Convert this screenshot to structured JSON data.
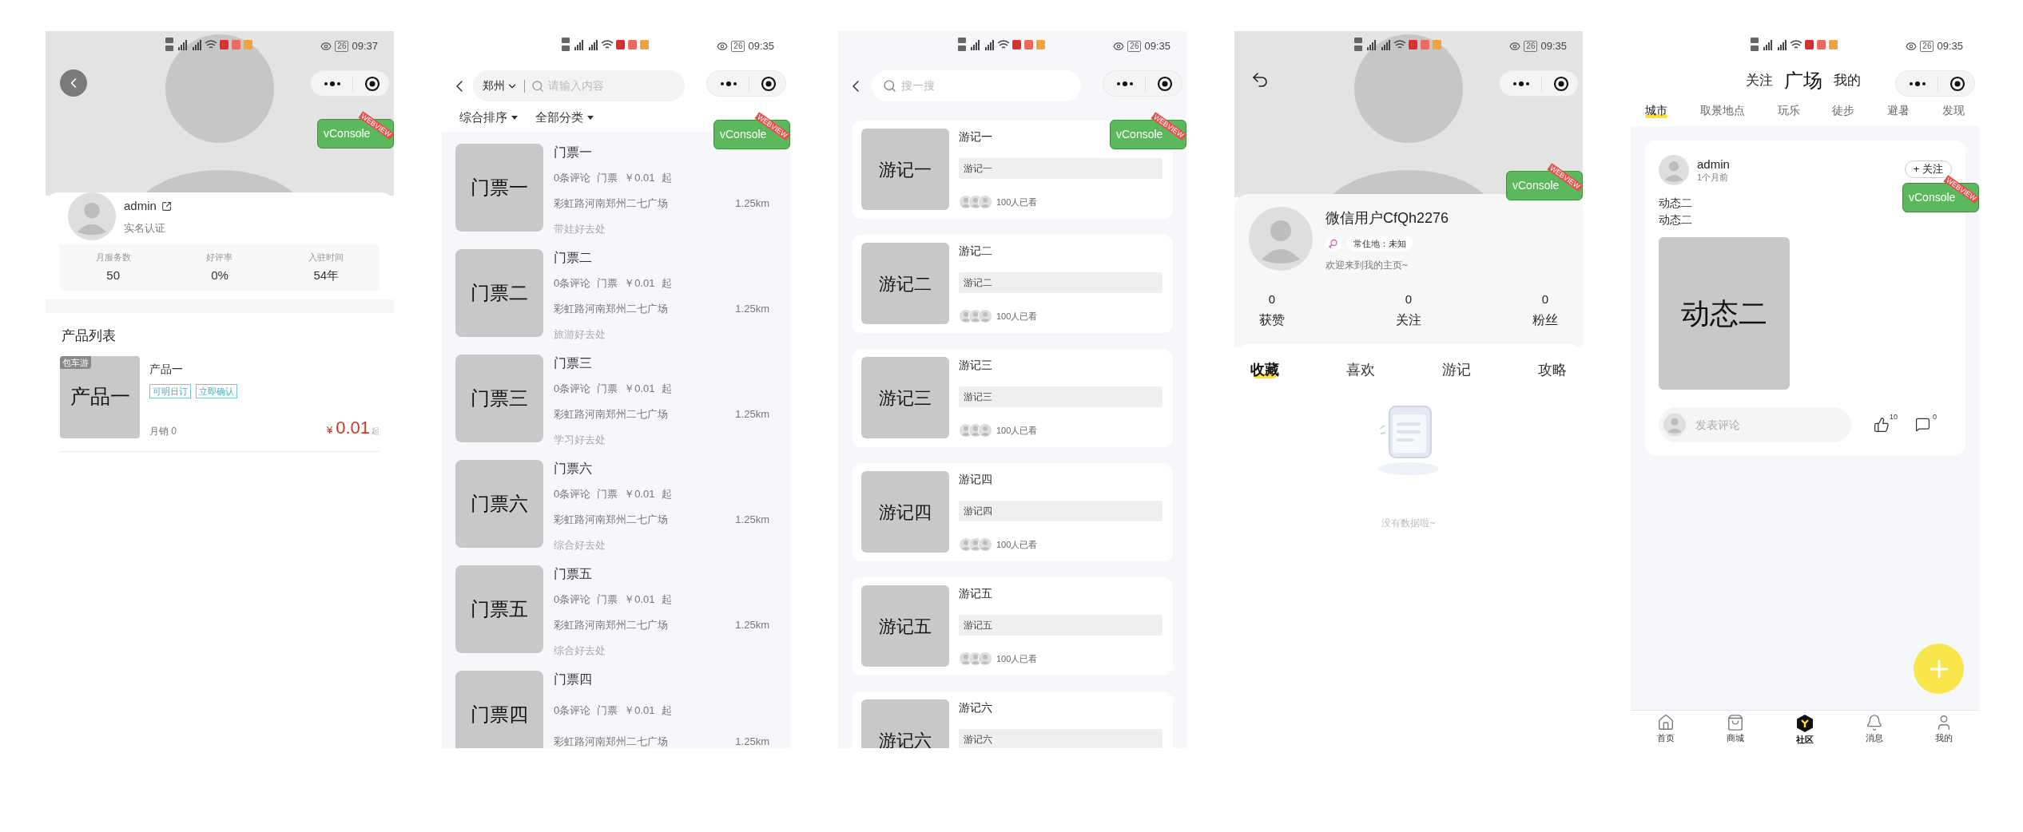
{
  "shop": {
    "status_bar": {
      "battery": "26",
      "time": "09:37"
    },
    "vconsole": {
      "label": "vConsole",
      "ribbon": "WEBVIEW"
    },
    "profile": {
      "name": "admin",
      "subtitle": "实名认证"
    },
    "stats": [
      {
        "label": "月服务数",
        "value": "50"
      },
      {
        "label": "好评率",
        "value": "0%"
      },
      {
        "label": "入驻时间",
        "value": "54年"
      }
    ],
    "section_title": "产品列表",
    "products": [
      {
        "tag": "包车游",
        "image_text": "产品一",
        "name": "产品一",
        "badges": [
          "可明日订",
          "立即确认"
        ],
        "sales": "月销 0",
        "currency": "¥",
        "price": "0.01",
        "price_suffix": "起"
      }
    ]
  },
  "tickets": {
    "status_bar": {
      "battery": "26",
      "time": "09:35"
    },
    "vconsole": {
      "label": "vConsole",
      "ribbon": "WEBVIEW"
    },
    "search": {
      "city": "郑州",
      "placeholder": "请输入内容"
    },
    "filters": [
      "综合排序",
      "全部分类"
    ],
    "items": [
      {
        "image_text": "门票一",
        "name": "门票一",
        "reviews": "0条评论",
        "type": "门票",
        "price": "￥0.01",
        "price_suffix": "起",
        "address": "彩虹路河南郑州二七广场",
        "distance": "1.25km",
        "tagline": "带娃好去处"
      },
      {
        "image_text": "门票二",
        "name": "门票二",
        "reviews": "0条评论",
        "type": "门票",
        "price": "￥0.01",
        "price_suffix": "起",
        "address": "彩虹路河南郑州二七广场",
        "distance": "1.25km",
        "tagline": "旅游好去处"
      },
      {
        "image_text": "门票三",
        "name": "门票三",
        "reviews": "0条评论",
        "type": "门票",
        "price": "￥0.01",
        "price_suffix": "起",
        "address": "彩虹路河南郑州二七广场",
        "distance": "1.25km",
        "tagline": "学习好去处"
      },
      {
        "image_text": "门票六",
        "name": "门票六",
        "reviews": "0条评论",
        "type": "门票",
        "price": "￥0.01",
        "price_suffix": "起",
        "address": "彩虹路河南郑州二七广场",
        "distance": "1.25km",
        "tagline": "综合好去处"
      },
      {
        "image_text": "门票五",
        "name": "门票五",
        "reviews": "0条评论",
        "type": "门票",
        "price": "￥0.01",
        "price_suffix": "起",
        "address": "彩虹路河南郑州二七广场",
        "distance": "1.25km",
        "tagline": "综合好去处"
      },
      {
        "image_text": "门票四",
        "name": "门票四",
        "reviews": "0条评论",
        "type": "门票",
        "price": "￥0.01",
        "price_suffix": "起",
        "address": "彩虹路河南郑州二七广场",
        "distance": "1.25km"
      }
    ]
  },
  "notes": {
    "status_bar": {
      "battery": "26",
      "time": "09:35"
    },
    "vconsole": {
      "label": "vConsole",
      "ribbon": "WEBVIEW"
    },
    "search": {
      "placeholder": "搜一搜"
    },
    "items": [
      {
        "image_text": "游记一",
        "title": "游记一",
        "excerpt": "游记一",
        "views": "100人已看"
      },
      {
        "image_text": "游记二",
        "title": "游记二",
        "excerpt": "游记二",
        "views": "100人已看"
      },
      {
        "image_text": "游记三",
        "title": "游记三",
        "excerpt": "游记三",
        "views": "100人已看"
      },
      {
        "image_text": "游记四",
        "title": "游记四",
        "excerpt": "游记四",
        "views": "100人已看"
      },
      {
        "image_text": "游记五",
        "title": "游记五",
        "excerpt": "游记五",
        "views": "100人已看"
      },
      {
        "image_text": "游记六",
        "title": "游记六",
        "excerpt": "游记六"
      }
    ]
  },
  "profile": {
    "status_bar": {
      "battery": "26",
      "time": "09:35"
    },
    "vconsole": {
      "label": "vConsole",
      "ribbon": "WEBVIEW"
    },
    "user": {
      "name": "微信用户CfQh2276",
      "location": "常住地：未知",
      "bio": "欢迎来到我的主页~"
    },
    "stats": [
      {
        "value": "0",
        "label": "获赞"
      },
      {
        "value": "0",
        "label": "关注"
      },
      {
        "value": "0",
        "label": "粉丝"
      }
    ],
    "tabs": [
      {
        "label": "收藏",
        "selected": true
      },
      {
        "label": "喜欢",
        "selected": false
      },
      {
        "label": "游记",
        "selected": false
      },
      {
        "label": "攻略",
        "selected": false
      }
    ],
    "empty_text": "没有数据啦~"
  },
  "square": {
    "status_bar": {
      "battery": "26",
      "time": "09:35"
    },
    "vconsole": {
      "label": "vConsole",
      "ribbon": "WEBVIEW"
    },
    "header_tabs": [
      {
        "label": "关注",
        "selected": false
      },
      {
        "label": "广场",
        "selected": true
      },
      {
        "label": "我的",
        "selected": false
      }
    ],
    "categories": [
      {
        "label": "城市",
        "selected": true
      },
      {
        "label": "取景地点",
        "selected": false
      },
      {
        "label": "玩乐",
        "selected": false
      },
      {
        "label": "徒步",
        "selected": false
      },
      {
        "label": "避暑",
        "selected": false
      },
      {
        "label": "发现",
        "selected": false
      }
    ],
    "post": {
      "author": "admin",
      "time": "1个月前",
      "follow": "+ 关注",
      "lines": [
        "动态二",
        "动态二"
      ],
      "image_text": "动态二",
      "comment_placeholder": "发表评论",
      "likes": "10",
      "comments": "0"
    },
    "nav": [
      {
        "label": "首页",
        "selected": false
      },
      {
        "label": "商城",
        "selected": false
      },
      {
        "label": "社区",
        "selected": true
      },
      {
        "label": "消息",
        "selected": false
      },
      {
        "label": "我的",
        "selected": false
      }
    ]
  }
}
